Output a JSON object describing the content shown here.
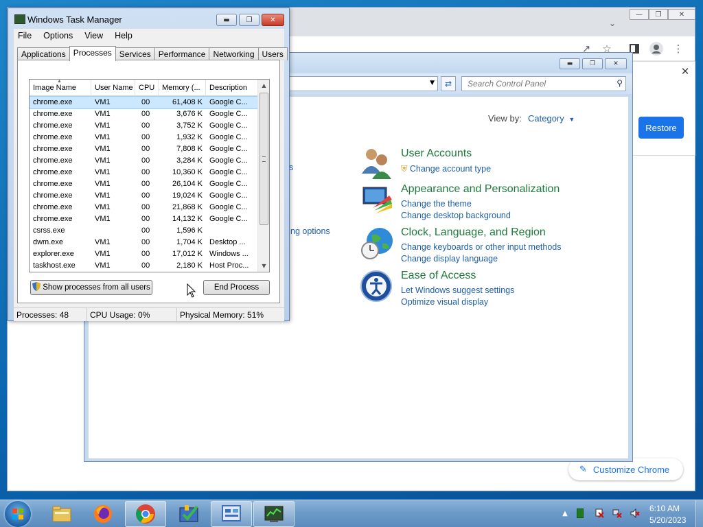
{
  "chrome": {
    "restore_label": "Restore",
    "customize_label": "Customize Chrome"
  },
  "control_panel": {
    "search_placeholder": "Search Control Panel",
    "view_by_label": "View by:",
    "view_by_value": "Category",
    "partial_link_1": "s",
    "partial_link_2": "ng options",
    "categories": [
      {
        "title": "User Accounts",
        "links": [
          "Change account type"
        ],
        "icon": "user-accounts-icon"
      },
      {
        "title": "Appearance and Personalization",
        "links": [
          "Change the theme",
          "Change desktop background"
        ],
        "icon": "appearance-icon"
      },
      {
        "title": "Clock, Language, and Region",
        "links": [
          "Change keyboards or other input methods",
          "Change display language"
        ],
        "icon": "clock-globe-icon"
      },
      {
        "title": "Ease of Access",
        "links": [
          "Let Windows suggest settings",
          "Optimize visual display"
        ],
        "icon": "ease-of-access-icon"
      }
    ]
  },
  "task_manager": {
    "title": "Windows Task Manager",
    "menu": [
      "File",
      "Options",
      "View",
      "Help"
    ],
    "tabs": [
      "Applications",
      "Processes",
      "Services",
      "Performance",
      "Networking",
      "Users"
    ],
    "active_tab": "Processes",
    "columns": [
      "Image Name",
      "User Name",
      "CPU",
      "Memory (...",
      "Description"
    ],
    "rows": [
      [
        "chrome.exe",
        "VM1",
        "00",
        "61,408 K",
        "Google C..."
      ],
      [
        "chrome.exe",
        "VM1",
        "00",
        "3,676 K",
        "Google C..."
      ],
      [
        "chrome.exe",
        "VM1",
        "00",
        "3,752 K",
        "Google C..."
      ],
      [
        "chrome.exe",
        "VM1",
        "00",
        "1,932 K",
        "Google C..."
      ],
      [
        "chrome.exe",
        "VM1",
        "00",
        "7,808 K",
        "Google C..."
      ],
      [
        "chrome.exe",
        "VM1",
        "00",
        "3,284 K",
        "Google C..."
      ],
      [
        "chrome.exe",
        "VM1",
        "00",
        "10,360 K",
        "Google C..."
      ],
      [
        "chrome.exe",
        "VM1",
        "00",
        "26,104 K",
        "Google C..."
      ],
      [
        "chrome.exe",
        "VM1",
        "00",
        "19,024 K",
        "Google C..."
      ],
      [
        "chrome.exe",
        "VM1",
        "00",
        "21,868 K",
        "Google C..."
      ],
      [
        "chrome.exe",
        "VM1",
        "00",
        "14,132 K",
        "Google C..."
      ],
      [
        "csrss.exe",
        "",
        "00",
        "1,596 K",
        ""
      ],
      [
        "dwm.exe",
        "VM1",
        "00",
        "1,704 K",
        "Desktop ..."
      ],
      [
        "explorer.exe",
        "VM1",
        "00",
        "17,012 K",
        "Windows ..."
      ],
      [
        "taskhost.exe",
        "VM1",
        "00",
        "2,180 K",
        "Host Proc..."
      ]
    ],
    "show_all_label": "Show processes from all users",
    "end_process_label": "End Process",
    "status": {
      "processes": "Processes: 48",
      "cpu": "CPU Usage: 0%",
      "memory": "Physical Memory: 51%"
    }
  },
  "taskbar": {
    "pinned": [
      "explorer",
      "firefox",
      "chrome",
      "action-center",
      "control-panel",
      "task-manager"
    ],
    "clock_time": "6:10 AM",
    "clock_date": "5/20/2023"
  }
}
